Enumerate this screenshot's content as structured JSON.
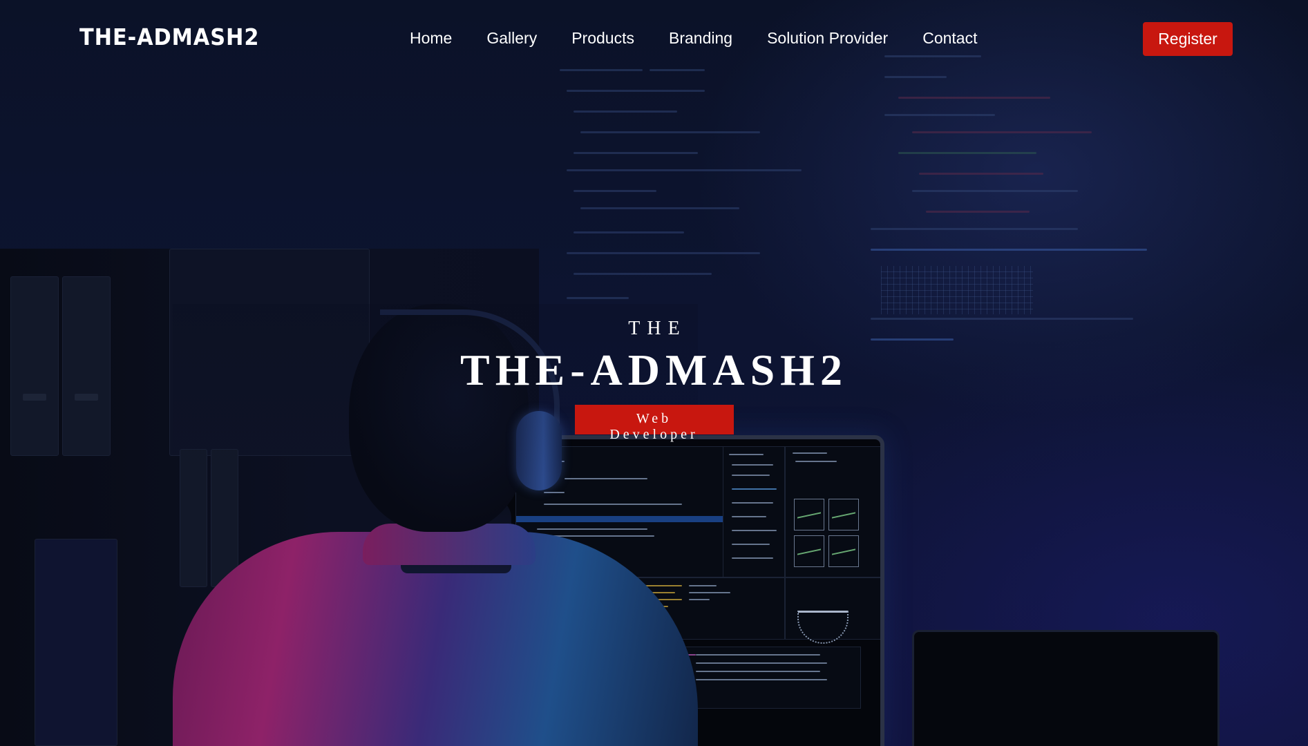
{
  "brand": {
    "logo": "THE-ADMASH2"
  },
  "nav": {
    "items": [
      {
        "label": "Home"
      },
      {
        "label": "Gallery"
      },
      {
        "label": "Products"
      },
      {
        "label": "Branding"
      },
      {
        "label": "Solution Provider"
      },
      {
        "label": "Contact"
      }
    ],
    "register_label": "Register"
  },
  "hero": {
    "pre_title": "THE",
    "title": "THE-ADMASH2",
    "tagline": "Web Developer"
  },
  "colors": {
    "accent": "#c8170f",
    "background": "#0d1431"
  }
}
